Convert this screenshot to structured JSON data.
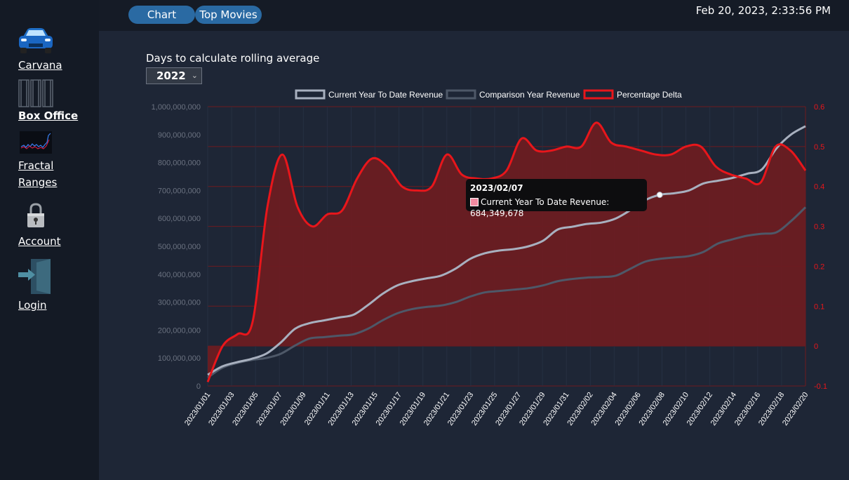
{
  "header": {
    "tabs": [
      {
        "label": "Chart"
      },
      {
        "label": "Top Movies"
      }
    ],
    "datetime": "Feb 20, 2023, 2:33:56 PM"
  },
  "sidebar": {
    "items": [
      {
        "label": "Carvana",
        "icon": "car-icon"
      },
      {
        "label": "Box Office",
        "icon": "film-strip-icon",
        "active": true
      },
      {
        "label": "Fractal",
        "label2": "Ranges",
        "icon": "stock-chart-icon"
      },
      {
        "label": "Account",
        "icon": "lock-icon"
      },
      {
        "label": "Login",
        "icon": "door-enter-icon"
      }
    ]
  },
  "controls": {
    "rolling_label": "Days to calculate rolling average",
    "year_value": "2022"
  },
  "tooltip": {
    "date": "2023/02/07",
    "text": "Current Year To Date Revenue: 684,349,678"
  },
  "colors": {
    "current": "#a8b0bf",
    "comparison": "#4e5868",
    "delta": "#e8161b",
    "delta_fill": "#6b1c22",
    "accent": "#2a6aa3"
  },
  "chart_data": {
    "type": "line",
    "legend": [
      "Current Year To Date Revenue",
      "Comparison Year Revenue",
      "Percentage Delta"
    ],
    "legend_position": "top",
    "ylim_left": [
      0,
      1000000000
    ],
    "ylim_right": [
      -0.1,
      0.6
    ],
    "left_ticks": [
      "0",
      "100,000,000",
      "200,000,000",
      "300,000,000",
      "400,000,000",
      "500,000,000",
      "600,000,000",
      "700,000,000",
      "800,000,000",
      "900,000,000",
      "1,000,000,000"
    ],
    "right_ticks": [
      "-0.1",
      "0",
      "0.1",
      "0.2",
      "0.3",
      "0.4",
      "0.5",
      "0.6"
    ],
    "x_tick_labels": [
      "2023/01/01",
      "2023/01/03",
      "2023/01/05",
      "2023/01/07",
      "2023/01/09",
      "2023/01/11",
      "2023/01/13",
      "2023/01/15",
      "2023/01/17",
      "2023/01/19",
      "2023/01/21",
      "2023/01/23",
      "2023/01/25",
      "2023/01/27",
      "2023/01/29",
      "2023/01/31",
      "2023/02/02",
      "2023/02/04",
      "2023/02/06",
      "2023/02/08",
      "2023/02/10",
      "2023/02/12",
      "2023/02/14",
      "2023/02/16",
      "2023/02/18",
      "2023/02/20"
    ],
    "series": [
      {
        "name": "Current Year To Date Revenue",
        "axis": "left",
        "values": [
          40000000,
          70000000,
          85000000,
          97000000,
          115000000,
          155000000,
          205000000,
          225000000,
          235000000,
          245000000,
          255000000,
          290000000,
          330000000,
          360000000,
          375000000,
          385000000,
          395000000,
          420000000,
          455000000,
          475000000,
          485000000,
          490000000,
          500000000,
          520000000,
          560000000,
          570000000,
          580000000,
          585000000,
          600000000,
          630000000,
          665000000,
          684349678,
          690000000,
          700000000,
          725000000,
          735000000,
          745000000,
          760000000,
          775000000,
          850000000,
          900000000,
          930000000
        ]
      },
      {
        "name": "Comparison Year Revenue",
        "axis": "left",
        "values": [
          30000000,
          65000000,
          82000000,
          93000000,
          100000000,
          115000000,
          145000000,
          170000000,
          175000000,
          180000000,
          185000000,
          205000000,
          235000000,
          260000000,
          275000000,
          283000000,
          288000000,
          300000000,
          320000000,
          335000000,
          340000000,
          345000000,
          350000000,
          360000000,
          375000000,
          383000000,
          388000000,
          390000000,
          395000000,
          420000000,
          445000000,
          455000000,
          460000000,
          465000000,
          480000000,
          510000000,
          525000000,
          538000000,
          545000000,
          550000000,
          590000000,
          640000000
        ]
      },
      {
        "name": "Percentage Delta",
        "axis": "right",
        "values": [
          -0.09,
          0.0,
          0.03,
          0.06,
          0.35,
          0.48,
          0.35,
          0.3,
          0.33,
          0.34,
          0.42,
          0.47,
          0.45,
          0.4,
          0.39,
          0.4,
          0.48,
          0.43,
          0.42,
          0.42,
          0.44,
          0.52,
          0.49,
          0.49,
          0.5,
          0.5,
          0.56,
          0.51,
          0.5,
          0.49,
          0.48,
          0.48,
          0.5,
          0.5,
          0.45,
          0.43,
          0.42,
          0.41,
          0.5,
          0.49,
          0.44
        ]
      }
    ]
  }
}
